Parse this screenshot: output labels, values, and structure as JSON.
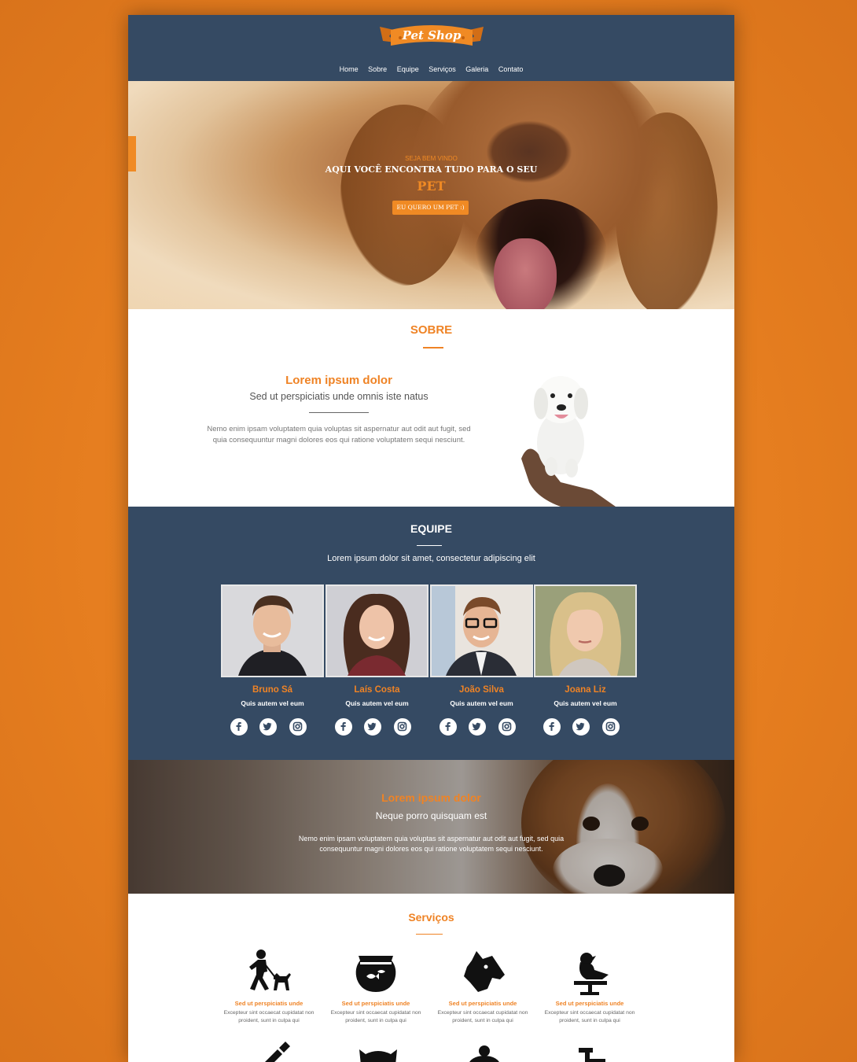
{
  "brand": {
    "logo_text": "Pet Shop"
  },
  "nav": [
    "Home",
    "Sobre",
    "Equipe",
    "Serviços",
    "Galeria",
    "Contato"
  ],
  "hero": {
    "kicker": "SEJA BEM VINDO",
    "title": "AQUI VOCÊ ENCONTRA TUDO PARA O SEU",
    "highlight": "PET",
    "button": "EU QUERO UM PET :)"
  },
  "sobre": {
    "section_title": "SOBRE",
    "heading": "Lorem ipsum dolor",
    "subheading": "Sed ut perspiciatis unde omnis iste natus",
    "paragraph": "Nemo enim ipsam voluptatem quia voluptas sit aspernatur aut odit aut fugit, sed quia consequuntur magni dolores eos qui ratione voluptatem sequi nesciunt."
  },
  "equipe": {
    "section_title": "EQUIPE",
    "subtitle": "Lorem ipsum dolor sit amet, consectetur adipiscing elit",
    "members": [
      {
        "name": "Bruno Sá",
        "role": "Quis autem vel eum"
      },
      {
        "name": "Laís Costa",
        "role": "Quis autem vel eum"
      },
      {
        "name": "João Silva",
        "role": "Quis autem vel eum"
      },
      {
        "name": "Joana Liz",
        "role": "Quis autem vel eum"
      }
    ],
    "social_icons": [
      "facebook-icon",
      "twitter-icon",
      "instagram-icon"
    ]
  },
  "banner": {
    "heading": "Lorem ipsum dolor",
    "subheading": "Neque porro quisquam est",
    "paragraph": "Nemo enim ipsam voluptatem quia voluptas sit aspernatur aut odit aut fugit, sed quia consequuntur magni dolores eos qui ratione voluptatem sequi nesciunt."
  },
  "servicos": {
    "section_title": "Serviços",
    "items": [
      {
        "icon": "dog-walker-icon",
        "title": "Sed ut perspiciatis unde",
        "text": "Excepteur sint occaecat cupidatat non proident, sunt in culpa qui"
      },
      {
        "icon": "fish-bowl-icon",
        "title": "Sed ut perspiciatis unde",
        "text": "Excepteur sint occaecat cupidatat non proident, sunt in culpa qui"
      },
      {
        "icon": "dog-head-icon",
        "title": "Sed ut perspiciatis unde",
        "text": "Excepteur sint occaecat cupidatat non proident, sunt in culpa qui"
      },
      {
        "icon": "bird-perch-icon",
        "title": "Sed ut perspiciatis unde",
        "text": "Excepteur sint occaecat cupidatat non proident, sunt in culpa qui"
      }
    ]
  },
  "colors": {
    "accent": "#ef8325",
    "navy": "#354a63",
    "background": "#e8801f"
  }
}
